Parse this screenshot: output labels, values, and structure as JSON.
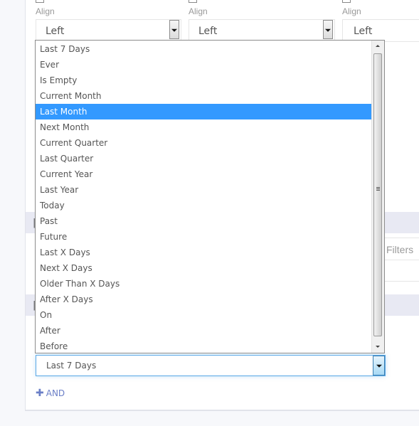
{
  "columns": [
    {
      "align_label": "Align",
      "align_value": "Left"
    },
    {
      "align_label": "Align",
      "align_value": "Left"
    },
    {
      "align_label": "Align",
      "align_value": "Left"
    }
  ],
  "filters_label": "Filters",
  "dropdown": {
    "selected_index": 4,
    "options": [
      "Last 7 Days",
      "Ever",
      "Is Empty",
      "Current Month",
      "Last Month",
      "Next Month",
      "Current Quarter",
      "Last Quarter",
      "Current Year",
      "Last Year",
      "Today",
      "Past",
      "Future",
      "Last X Days",
      "Next X Days",
      "Older Than X Days",
      "After X Days",
      "On",
      "After",
      "Before"
    ]
  },
  "date_filter_select": {
    "value": "Last 7 Days"
  },
  "and_button": {
    "icon": "plus-icon",
    "label": "AND"
  },
  "colors": {
    "accent": "#3399ff",
    "link": "#6b7fc7",
    "focus": "#5aa8e6",
    "section": "#e8e9f3"
  }
}
